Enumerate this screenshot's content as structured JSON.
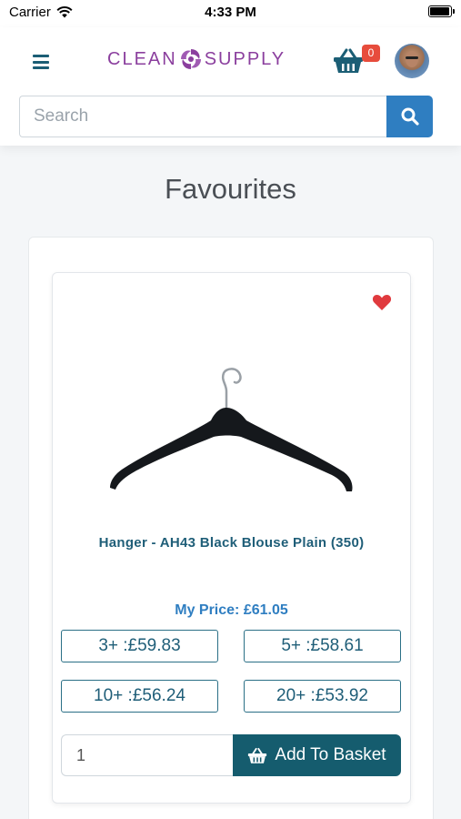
{
  "status_bar": {
    "carrier": "Carrier",
    "time": "4:33 PM"
  },
  "header": {
    "logo_left": "CLEAN",
    "logo_right": "SUPPLY",
    "basket_count": "0",
    "search": {
      "placeholder": "Search"
    }
  },
  "page": {
    "title": "Favourites"
  },
  "product": {
    "name": "Hanger - AH43 Black Blouse Plain (350)",
    "my_price": "My Price: £61.05",
    "tiers": [
      "3+ :£59.83",
      "5+ :£58.61",
      "10+ :£56.24",
      "20+ :£53.92"
    ],
    "quantity": "1",
    "add_label": "Add To Basket"
  },
  "colors": {
    "brand_purple": "#8b3f9e",
    "primary_teal": "#155c6e",
    "link_blue": "#2f7ec1",
    "heart_red": "#e03a3e",
    "badge_red": "#e74c3c"
  }
}
